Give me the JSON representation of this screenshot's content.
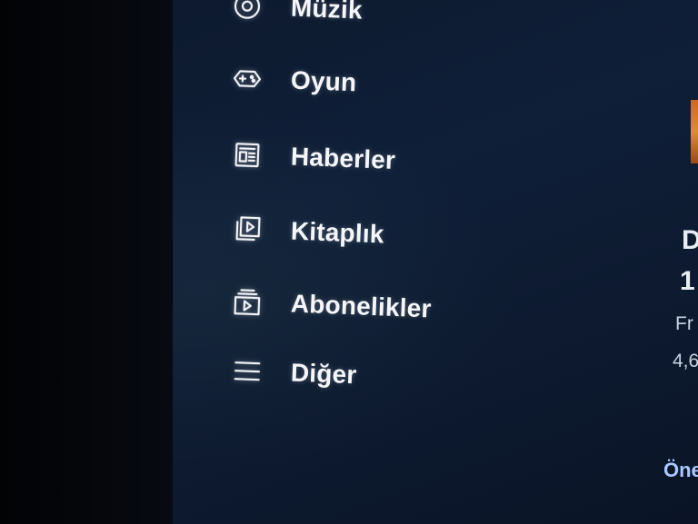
{
  "sidebar": {
    "items": [
      {
        "label": "Müzik",
        "icon": "music-icon"
      },
      {
        "label": "Oyun",
        "icon": "gamepad-icon"
      },
      {
        "label": "Haberler",
        "icon": "newspaper-icon"
      },
      {
        "label": "Kitaplık",
        "icon": "library-icon"
      },
      {
        "label": "Abonelikler",
        "icon": "subscriptions-icon"
      },
      {
        "label": "Diğer",
        "icon": "menu-icon"
      }
    ]
  },
  "content_panel": {
    "title_line1": "D",
    "title_line2": "1",
    "channel": "Fr",
    "meta": "4,6",
    "action": "Öne"
  },
  "colors": {
    "background": "#0f1f38",
    "text": "#f4f6fa",
    "accent": "#a9c8ff"
  }
}
